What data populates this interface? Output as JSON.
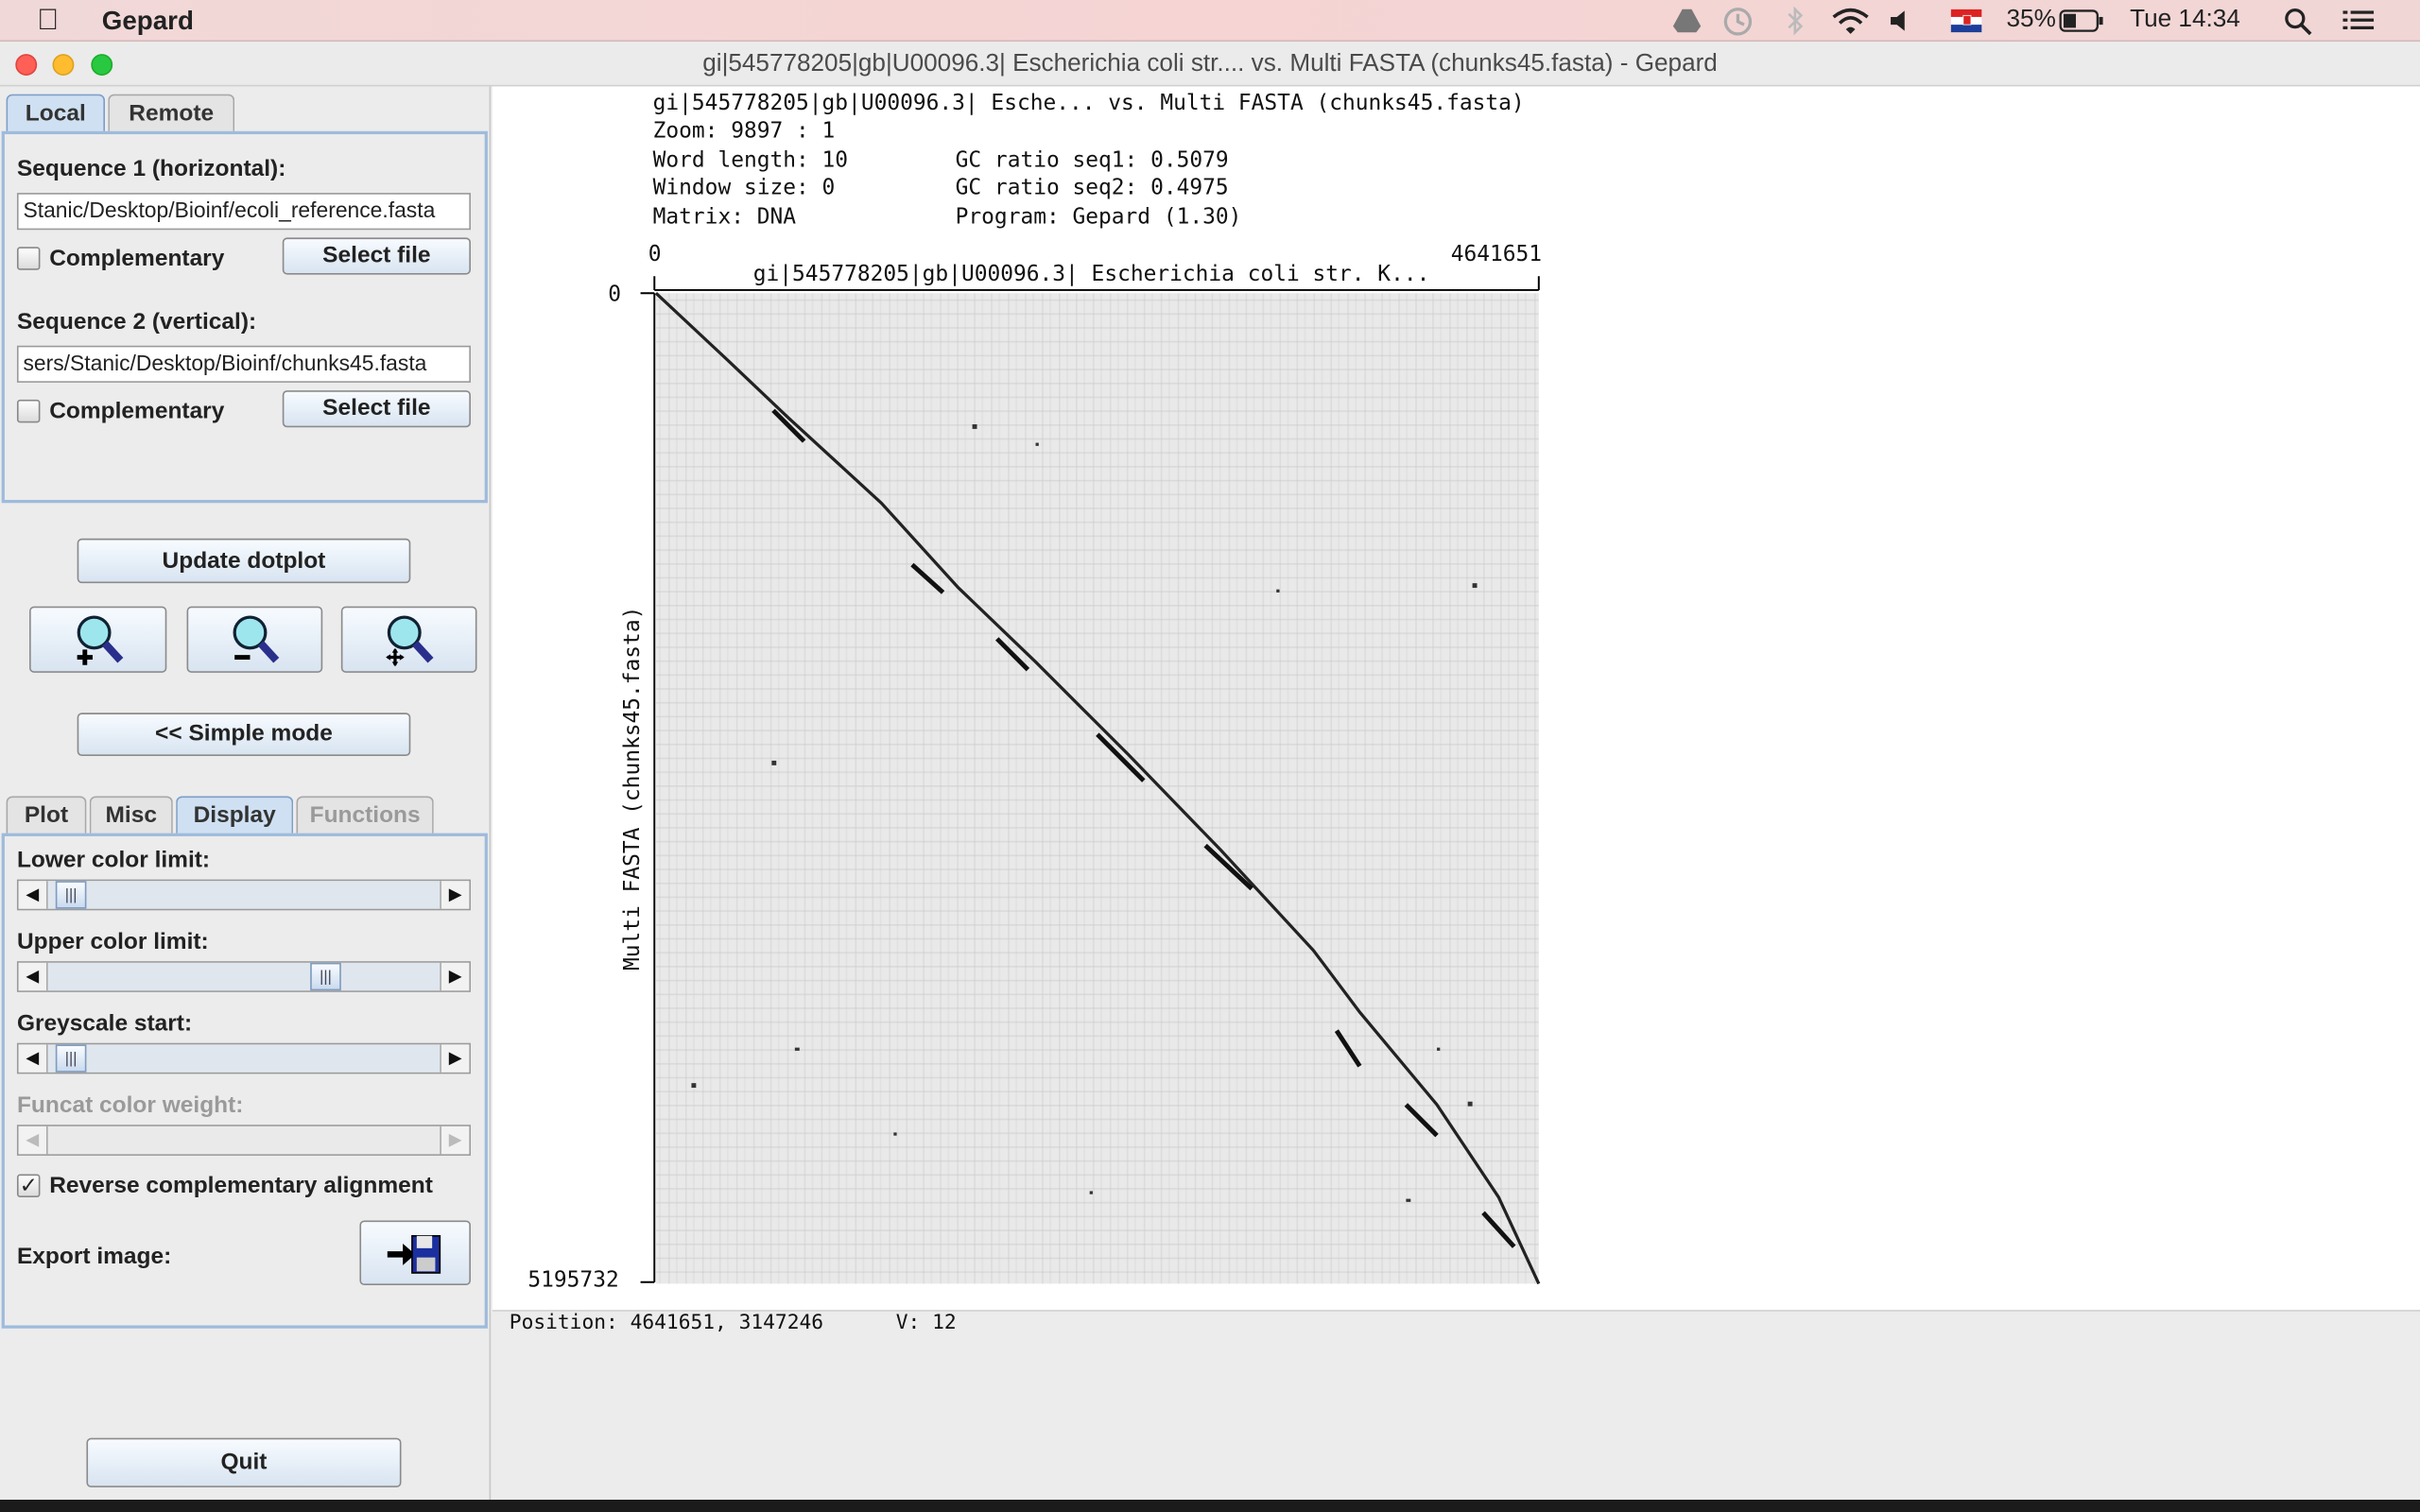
{
  "menubar": {
    "app_name": "Gepard",
    "battery": "35%",
    "clock": "Tue 14:34",
    "icons": [
      "drive-icon",
      "time-machine-icon",
      "bluetooth-icon",
      "wifi-icon",
      "volume-icon",
      "flag-icon",
      "battery-icon",
      "search-icon",
      "list-icon"
    ]
  },
  "window": {
    "title": "gi|545778205|gb|U00096.3| Escherichia coli str....  vs.  Multi FASTA (chunks45.fasta)  -  Gepard"
  },
  "left": {
    "tabs": [
      {
        "label": "Local",
        "active": true
      },
      {
        "label": "Remote",
        "active": false
      }
    ],
    "seq1_label": "Sequence 1 (horizontal):",
    "seq1_path": "Stanic/Desktop/Bioinf/ecoli_reference.fasta",
    "seq1_complementary": "Complementary",
    "seq1_select": "Select file",
    "seq2_label": "Sequence 2 (vertical):",
    "seq2_path": "sers/Stanic/Desktop/Bioinf/chunks45.fasta",
    "seq2_complementary": "Complementary",
    "seq2_select": "Select file",
    "update_button": "Update dotplot",
    "simple_mode_button": "<< Simple mode",
    "lower_tabs": [
      {
        "label": "Plot",
        "active": false,
        "enabled": true
      },
      {
        "label": "Misc",
        "active": false,
        "enabled": true
      },
      {
        "label": "Display",
        "active": true,
        "enabled": true
      },
      {
        "label": "Functions",
        "active": false,
        "enabled": false
      }
    ],
    "lower_color_limit_label": "Lower color limit:",
    "lower_color_limit_value": 0.02,
    "upper_color_limit_label": "Upper color limit:",
    "upper_color_limit_value": 0.72,
    "greyscale_start_label": "Greyscale start:",
    "greyscale_start_value": 0.02,
    "funcat_label": "Funcat color weight:",
    "reverse_label": "Reverse complementary alignment",
    "reverse_checked": "✓",
    "export_label": "Export image:",
    "quit_button": "Quit"
  },
  "plot": {
    "info_line1": "gi|545778205|gb|U00096.3| Esche... vs. Multi FASTA (chunks45.fasta)",
    "zoom": "Zoom: 9897 : 1",
    "word_length": "Word length: 10",
    "gc1": "GC ratio seq1: 0.5079",
    "window_size": "Window size: 0",
    "gc2": "GC ratio seq2: 0.4975",
    "matrix": "Matrix: DNA",
    "program": "Program: Gepard (1.30)",
    "x_start": "0",
    "x_end": "4641651",
    "x_title": "gi|545778205|gb|U00096.3| Escherichia coli str. K...",
    "y_start": "0",
    "y_end": "5195732",
    "y_title": "Multi FASTA (chunks45.fasta)"
  },
  "status": {
    "position": "Position: 4641651, 3147246",
    "value": "V: 12"
  }
}
